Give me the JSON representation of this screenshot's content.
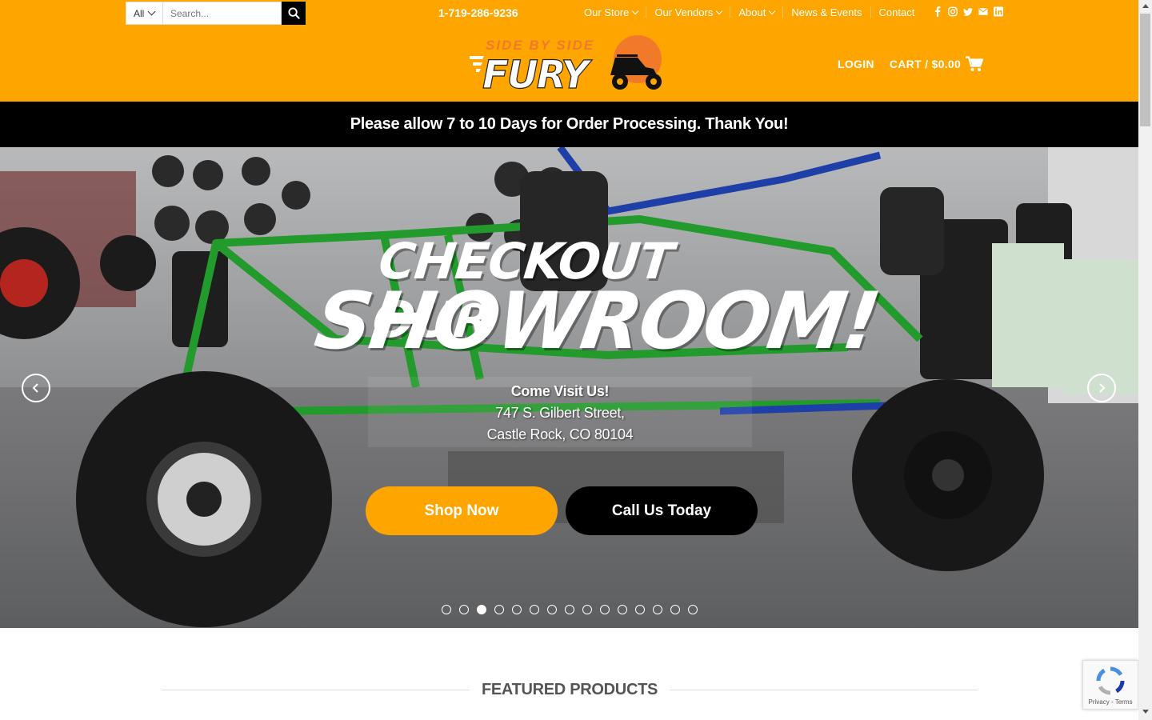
{
  "header": {
    "search": {
      "category": "All",
      "placeholder": "Search..."
    },
    "phone": "1-719-286-9236",
    "nav": [
      {
        "label": "Our Store",
        "has_dropdown": true
      },
      {
        "label": "Our Vendors",
        "has_dropdown": true
      },
      {
        "label": "About",
        "has_dropdown": true
      },
      {
        "label": "News & Events",
        "has_dropdown": false
      },
      {
        "label": "Contact",
        "has_dropdown": false
      }
    ],
    "social_icons": [
      "facebook-icon",
      "instagram-icon",
      "twitter-icon",
      "email-icon",
      "linkedin-icon"
    ],
    "logo": {
      "line1": "SIDE BY SIDE",
      "line2": "FURY"
    },
    "login_label": "LOGIN",
    "cart_label": "CART /",
    "cart_total": "$0.00"
  },
  "notice": "Please allow 7 to 10 Days for Order Processing. Thank You!",
  "hero": {
    "title_line1": "CHECKOUT OUR",
    "title_line2": "SHOWROOM!",
    "visit_heading": "Come Visit Us!",
    "address_line1": "747 S. Gilbert Street,",
    "address_line2": "Castle Rock, CO 80104",
    "shop_button": "Shop Now",
    "call_button": "Call Us Today",
    "slide_count": 15,
    "active_slide": 3
  },
  "featured": {
    "title": "FEATURED PRODUCTS"
  },
  "recaptcha": {
    "links": "Privacy - Terms"
  },
  "colors": {
    "brand_orange": "#ffa500",
    "notice_bg": "#000000",
    "text_dark": "#555555"
  }
}
